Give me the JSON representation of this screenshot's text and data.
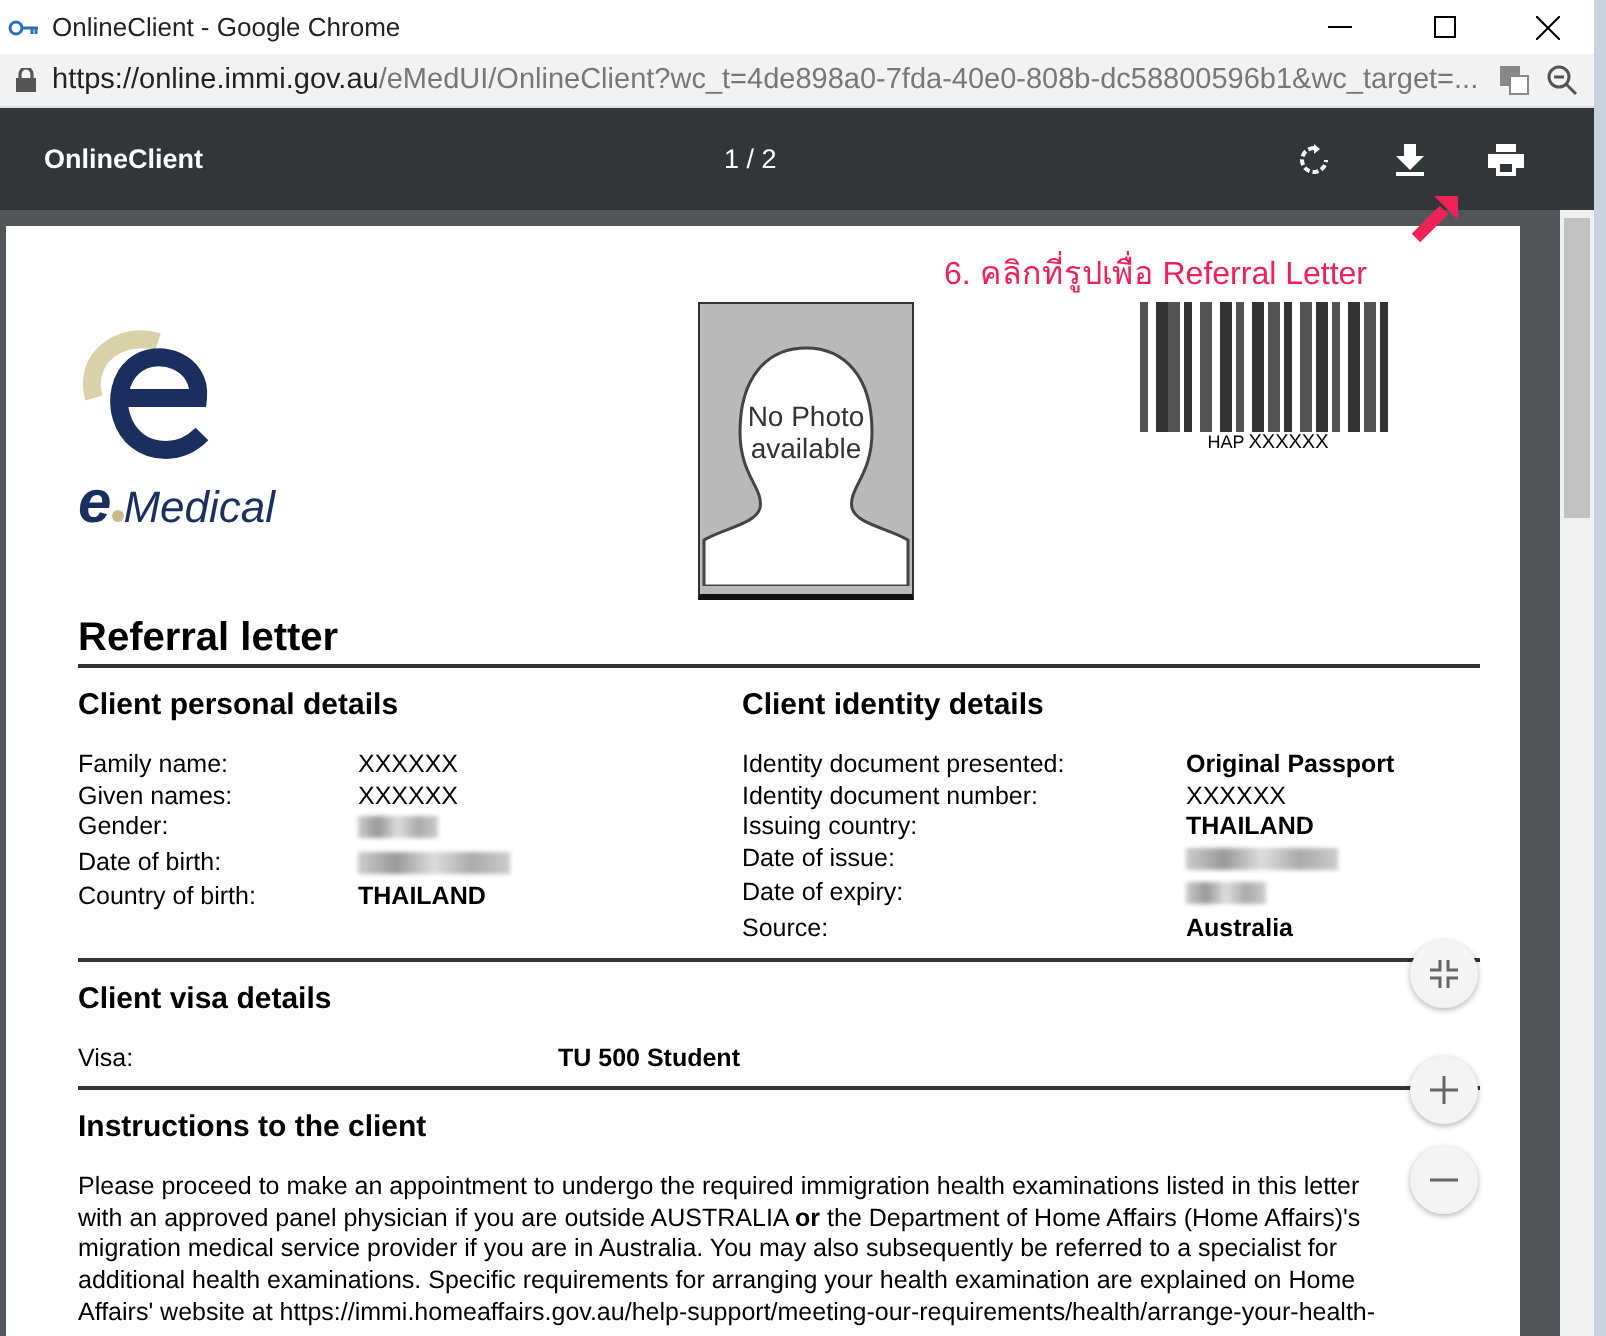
{
  "window": {
    "title": "OnlineClient - Google Chrome"
  },
  "address_bar": {
    "url_host": "https://online.immi.gov.au",
    "url_path": "/eMedUI/OnlineClient?wc_t=4de898a0-7fda-40e0-808b-dc58800596b1&wc_target=..."
  },
  "viewer_toolbar": {
    "title": "OnlineClient",
    "page_indicator": "1 / 2"
  },
  "annotation": {
    "text": "6. คลิกที่รูปเพื่อ Referral Letter"
  },
  "document": {
    "logo_letter": "e",
    "logo_text": "Medical",
    "photo_text": "No Photo available",
    "barcode_label": "HAP",
    "barcode_value": "XXXXXX",
    "title": "Referral letter",
    "personal": {
      "heading": "Client personal details",
      "rows": [
        {
          "label": "Family name:",
          "kind": "text",
          "value": "XXXXXX",
          "bold": false
        },
        {
          "label": "Given names:",
          "kind": "text",
          "value": "XXXXXX",
          "bold": false
        },
        {
          "label": "Gender:",
          "kind": "redacted"
        },
        {
          "label": "Date of birth:",
          "kind": "redacted"
        },
        {
          "label": "Country of birth:",
          "kind": "text",
          "value": "THAILAND",
          "bold": true
        }
      ]
    },
    "identity": {
      "heading": "Client identity details",
      "rows": [
        {
          "label": "Identity document presented:",
          "kind": "text",
          "value": "Original Passport",
          "bold": true
        },
        {
          "label": "Identity document number:",
          "kind": "text",
          "value": "XXXXXX",
          "bold": false
        },
        {
          "label": "Issuing country:",
          "kind": "text",
          "value": "THAILAND",
          "bold": true
        },
        {
          "label": "Date of issue:",
          "kind": "redacted"
        },
        {
          "label": "Date of expiry:",
          "kind": "redacted"
        },
        {
          "label": "Source:",
          "kind": "text",
          "value": "Australia",
          "bold": true
        }
      ]
    },
    "visa": {
      "heading": "Client visa details",
      "label": "Visa:",
      "value": "TU 500 Student"
    },
    "instructions": {
      "heading": "Instructions to the client",
      "text": "Please proceed to make an appointment to undergo the required immigration health examinations listed in this letter with an approved panel physician if you are outside AUSTRALIA **or** the Department of Home Affairs (Home Affairs)'s migration medical service provider if you are in Australia. You may also subsequently be referred to a specialist for additional health examinations. Specific requirements for arranging your health examination are explained on Home Affairs' website at https://immi.homeaffairs.gov.au/help-support/meeting-our-requirements/health/arrange-your-health-"
    }
  }
}
